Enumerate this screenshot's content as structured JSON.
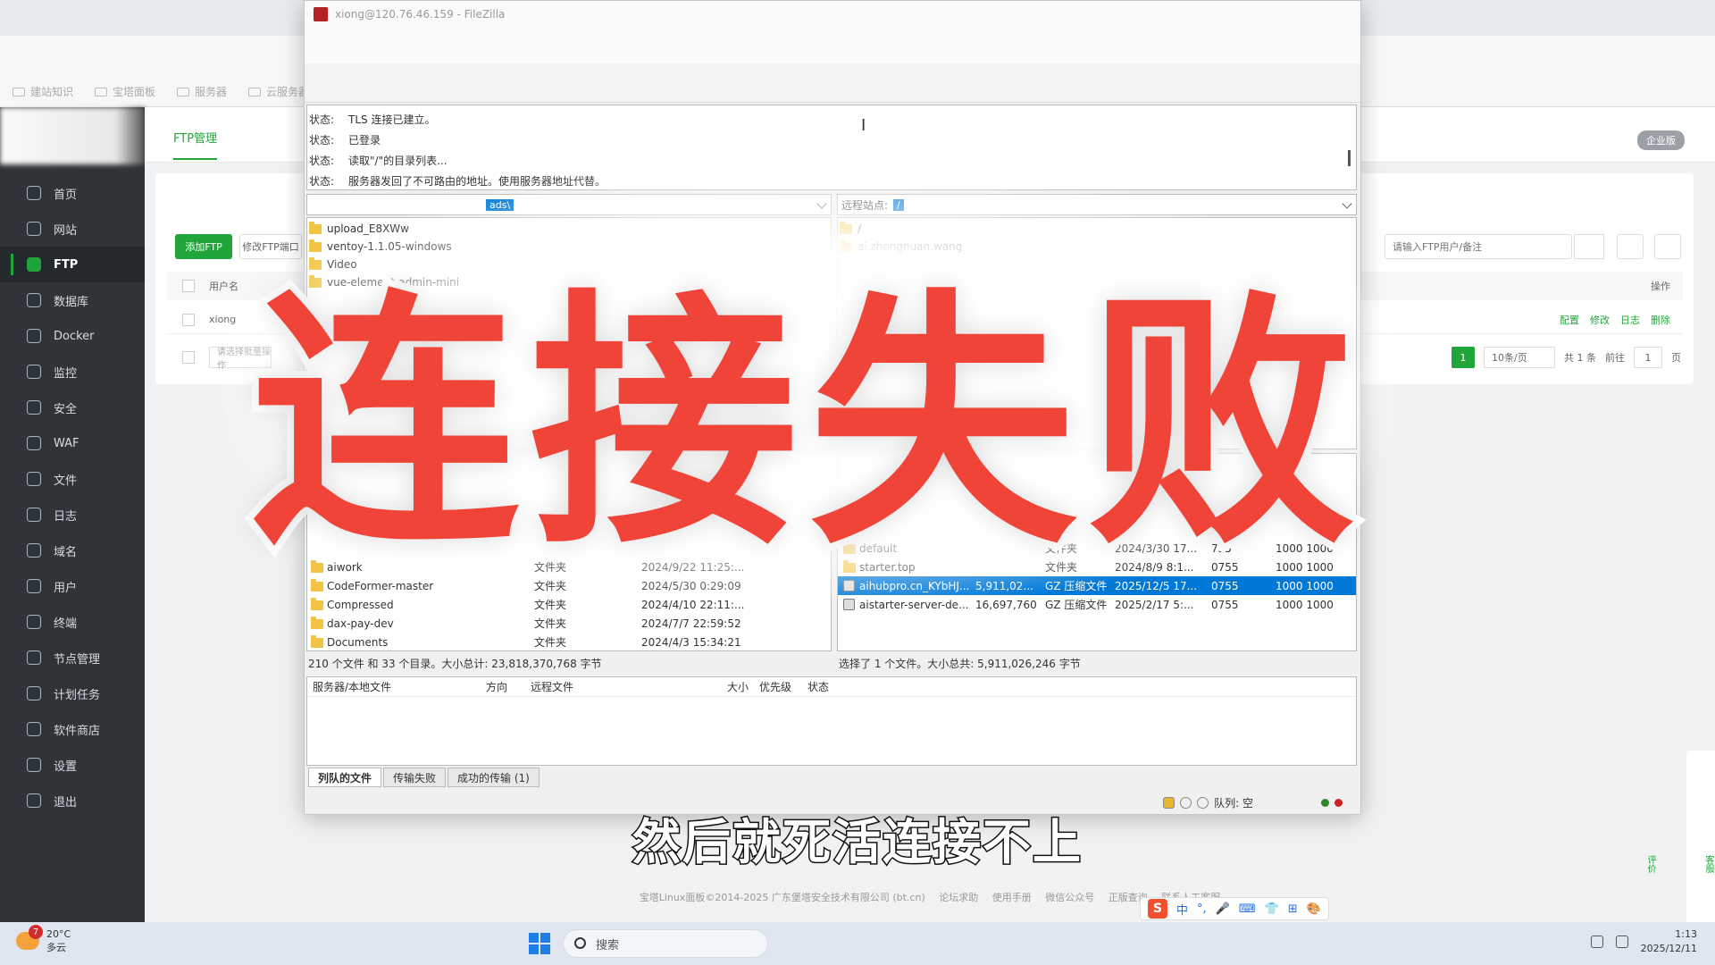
{
  "bookmarks": [
    "建站知识",
    "宝塔面板",
    "服务器",
    "云服务器"
  ],
  "sidebar": {
    "items": [
      {
        "label": "首页",
        "name": "home"
      },
      {
        "label": "网站",
        "name": "website"
      },
      {
        "label": "FTP",
        "name": "ftp",
        "active": true
      },
      {
        "label": "数据库",
        "name": "database"
      },
      {
        "label": "Docker",
        "name": "docker"
      },
      {
        "label": "监控",
        "name": "monitor"
      },
      {
        "label": "安全",
        "name": "security"
      },
      {
        "label": "WAF",
        "name": "waf"
      },
      {
        "label": "文件",
        "name": "files"
      },
      {
        "label": "日志",
        "name": "logs"
      },
      {
        "label": "域名",
        "name": "domain"
      },
      {
        "label": "用户",
        "name": "users"
      },
      {
        "label": "终端",
        "name": "terminal"
      },
      {
        "label": "节点管理",
        "name": "nodes"
      },
      {
        "label": "计划任务",
        "name": "cron"
      },
      {
        "label": "软件商店",
        "name": "store"
      },
      {
        "label": "设置",
        "name": "settings"
      },
      {
        "label": "退出",
        "name": "logout"
      }
    ]
  },
  "main": {
    "tab": "FTP管理",
    "enterprise": "企业版",
    "add_ftp": "添加FTP",
    "modify_port": "修改FTP端口",
    "search_placeholder": "请输入FTP用户/备注",
    "col_username": "用户名",
    "col_ops": "操作",
    "row_user": "xiong",
    "row_ops": [
      "配置",
      "修改",
      "日志",
      "删除"
    ],
    "bulk_placeholder": "请选择批量操作",
    "pager": {
      "current": "1",
      "size": "10条/页",
      "total": "共 1 条",
      "goto": "前往",
      "page_input": "1",
      "page_suffix": "页"
    },
    "footer": [
      "宝塔Linux面板©2014-2025 广东堡塔安全技术有限公司 (bt.cn)",
      "论坛求助",
      "使用手册",
      "微信公众号",
      "正版查询",
      "联系人工客服"
    ],
    "side_helpers": [
      "客服",
      "评价"
    ]
  },
  "filezilla": {
    "title": "xiong@120.76.46.159 - FileZilla",
    "log_label": "状态:",
    "log": [
      {
        "label": "状态:",
        "text": "TLS 连接已建立。"
      },
      {
        "label": "状态:",
        "text": "已登录"
      },
      {
        "label": "状态:",
        "text": "读取\"/\"的目录列表..."
      },
      {
        "label": "状态:",
        "text": "服务器发回了不可路由的地址。使用服务器地址代替。"
      }
    ],
    "local_path": "ads\\",
    "remote_site_label": "远程站点:",
    "remote_path": "/",
    "local_tree": [
      "upload_E8XWw",
      "ventoy-1.1.05-windows",
      "Video",
      "vue-element-admin-mini"
    ],
    "remote_tree": [
      "/",
      "ai.zhongnuan.wang"
    ],
    "local_files": [
      {
        "name": "aiwork",
        "type": "文件夹",
        "date": "2024/9/22 11:25:..."
      },
      {
        "name": "CodeFormer-master",
        "type": "文件夹",
        "date": "2024/5/30 0:29:09"
      },
      {
        "name": "Compressed",
        "type": "文件夹",
        "date": "2024/4/10 22:11:..."
      },
      {
        "name": "dax-pay-dev",
        "type": "文件夹",
        "date": "2024/7/7 22:59:52"
      },
      {
        "name": "Documents",
        "type": "文件夹",
        "date": "2024/4/3 15:34:21"
      }
    ],
    "remote_files": [
      {
        "name": "default",
        "size": "",
        "type": "文件夹",
        "date": "2024/3/30 17...",
        "perm": "755",
        "owner": "1000 1000",
        "selected": false
      },
      {
        "name": "starter.top",
        "size": "",
        "type": "文件夹",
        "date": "2024/8/9 8:1...",
        "perm": "0755",
        "owner": "1000 1000",
        "selected": false
      },
      {
        "name": "aihubpro.cn_KYbHJ....",
        "size": "5,911,02...",
        "type": "GZ 压缩文件",
        "date": "2025/12/5 17...",
        "perm": "0755",
        "owner": "1000 1000",
        "selected": true
      },
      {
        "name": "aistarter-server-de...",
        "size": "16,697,760",
        "type": "GZ 压缩文件",
        "date": "2025/2/17 5:...",
        "perm": "0755",
        "owner": "1000 1000",
        "selected": false
      }
    ],
    "local_status": "210 个文件 和 33 个目录。大小总计: 23,818,370,768 字节",
    "remote_status": "选择了 1 个文件。大小总共: 5,911,026,246 字节",
    "queue_cols": [
      "服务器/本地文件",
      "方向",
      "远程文件",
      "大小",
      "优先级",
      "状态"
    ],
    "queue_tabs": [
      "列队的文件",
      "传输失败",
      "成功的传输 (1)"
    ],
    "queue_status": "队列: 空"
  },
  "overlay": {
    "title": "连接失败",
    "subtitle": "然后就死活连接不上"
  },
  "taskbar": {
    "weather_badge": "7",
    "temp": "20°C",
    "condition": "多云",
    "search": "搜索",
    "ime": [
      "中",
      "°,",
      "🎤",
      "⌨",
      "👕",
      "⊞",
      "🎨"
    ],
    "time": "1:13",
    "date": "2025/12/11"
  },
  "colors": {
    "accent": "#20a53a",
    "overlay_red": "#f04438",
    "selection": "#0078d7"
  }
}
